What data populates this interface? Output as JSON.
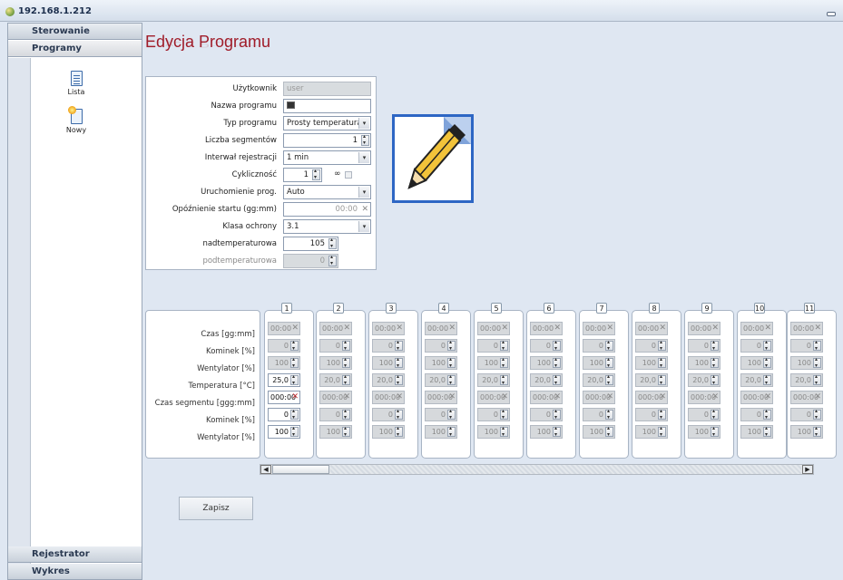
{
  "window": {
    "title": "192.168.1.212"
  },
  "nav": {
    "sections": [
      "Sterowanie",
      "Programy",
      "Rejestrator",
      "Wykres"
    ],
    "program_items": [
      {
        "label": "Lista",
        "icon": "document-list-icon"
      },
      {
        "label": "Nowy",
        "icon": "new-document-icon"
      }
    ]
  },
  "page": {
    "title": "Edycja Programu"
  },
  "form": {
    "user_label": "Użytkownik",
    "user_value": "user",
    "name_label": "Nazwa programu",
    "name_value": "",
    "type_label": "Typ programu",
    "type_value": "Prosty temperatura",
    "segments_label": "Liczba segmentów",
    "segments_value": "1",
    "interval_label": "Interwał rejestracji",
    "interval_value": "1 min",
    "cyclic_label": "Cykliczność",
    "cyclic_value": "1",
    "infinity_label": "∞",
    "start_label": "Uruchomienie prog.",
    "start_value": "Auto",
    "delay_label": "Opóźnienie startu (gg:mm)",
    "delay_value": "00:00",
    "class_label": "Klasa ochrony",
    "class_value": "3.1",
    "over_label": "nadtemperaturowa",
    "over_value": "105",
    "under_label": "podtemperaturowa",
    "under_value": "0"
  },
  "segments": {
    "row_labels": [
      "Czas [gg:mm]",
      "Kominek [%]",
      "Wentylator [%]",
      "Temperatura [°C]",
      "Czas segmentu [ggg:mm]",
      "Kominek [%]",
      "Wentylator [%]"
    ],
    "numbers": [
      "1",
      "2",
      "3",
      "4",
      "5",
      "6",
      "7",
      "8",
      "9",
      "10",
      "11"
    ],
    "enabled_values": [
      "00:00",
      "0",
      "100",
      "25,0",
      "000:00",
      "0",
      "100"
    ],
    "disabled_values": [
      "00:00",
      "0",
      "100",
      "20,0",
      "000:00",
      "0",
      "100"
    ]
  },
  "actions": {
    "save_label": "Zapisz"
  }
}
